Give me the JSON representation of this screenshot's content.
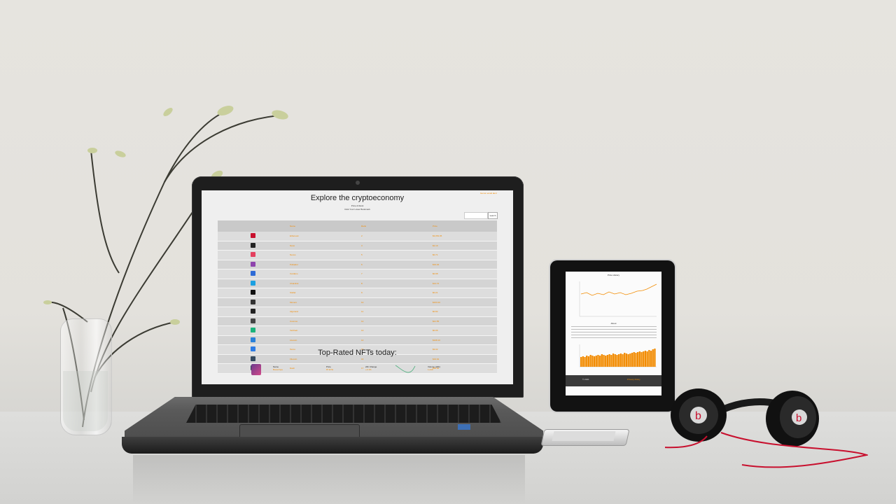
{
  "laptop_page": {
    "top_right_link": "Get an email alert",
    "title": "Explore the cryptoeconomy",
    "subtitle_1": "Price & Rank",
    "subtitle_2": "Click Your Lower Bookmark",
    "search_button": "search",
    "table": {
      "headers": [
        "",
        "Name",
        "Rank",
        "Price"
      ],
      "rows": [
        {
          "logo_color": "#c8102e",
          "name": "Ethereum",
          "rank": "2",
          "price": "$3,054.05"
        },
        {
          "logo_color": "#222222",
          "name": "Nano",
          "rank": "3",
          "price": "$2.19"
        },
        {
          "logo_color": "#e4405f",
          "name": "Nexus",
          "rank": "5",
          "price": "$0.71"
        },
        {
          "logo_color": "#8e44ad",
          "name": "Polkadot",
          "rank": "6",
          "price": "$19.04"
        },
        {
          "logo_color": "#2e6bd6",
          "name": "Cardano",
          "rank": "7",
          "price": "$0.98"
        },
        {
          "logo_color": "#1ba0e1",
          "name": "Chainlink",
          "rank": "8",
          "price": "$14.72"
        },
        {
          "logo_color": "#111111",
          "name": "Stellar",
          "rank": "9",
          "price": "$0.21"
        },
        {
          "logo_color": "#333333",
          "name": "Monero",
          "rank": "10",
          "price": "$163.20"
        },
        {
          "logo_color": "#222222",
          "name": "Algorand",
          "rank": "11",
          "price": "$0.82"
        },
        {
          "logo_color": "#444444",
          "name": "Cosmos",
          "rank": "12",
          "price": "$21.55"
        },
        {
          "logo_color": "#1ab37b",
          "name": "VeChain",
          "rank": "13",
          "price": "$0.06"
        },
        {
          "logo_color": "#2980d9",
          "name": "Litecoin",
          "rank": "14",
          "price": "$108.10"
        },
        {
          "logo_color": "#2c7be5",
          "name": "Tezos",
          "rank": "15",
          "price": "$3.02"
        },
        {
          "logo_color": "#34495e",
          "name": "Filecoin",
          "rank": "16",
          "price": "$19.64"
        },
        {
          "logo_color": "#2c3e50",
          "name": "Dash",
          "rank": "17",
          "price": "$96.40"
        }
      ]
    },
    "nft_section_title": "Top-Rated NFTs today:",
    "nft": {
      "name_label": "Name",
      "name_value": "Bored Ape",
      "price_label": "Price",
      "price_value": "87 ETH",
      "change_label": "24h Change",
      "change_value": "+3.1%",
      "volume_label": "Volume (24h)",
      "volume_value": "1,240"
    }
  },
  "tablet_page": {
    "chart_title": "Price History",
    "section_subtitle": "About",
    "footer_left": "© 2021",
    "footer_right": "Privacy Policy"
  },
  "colors": {
    "accent": "#f28b00",
    "table_header": "#c9c9c9"
  }
}
